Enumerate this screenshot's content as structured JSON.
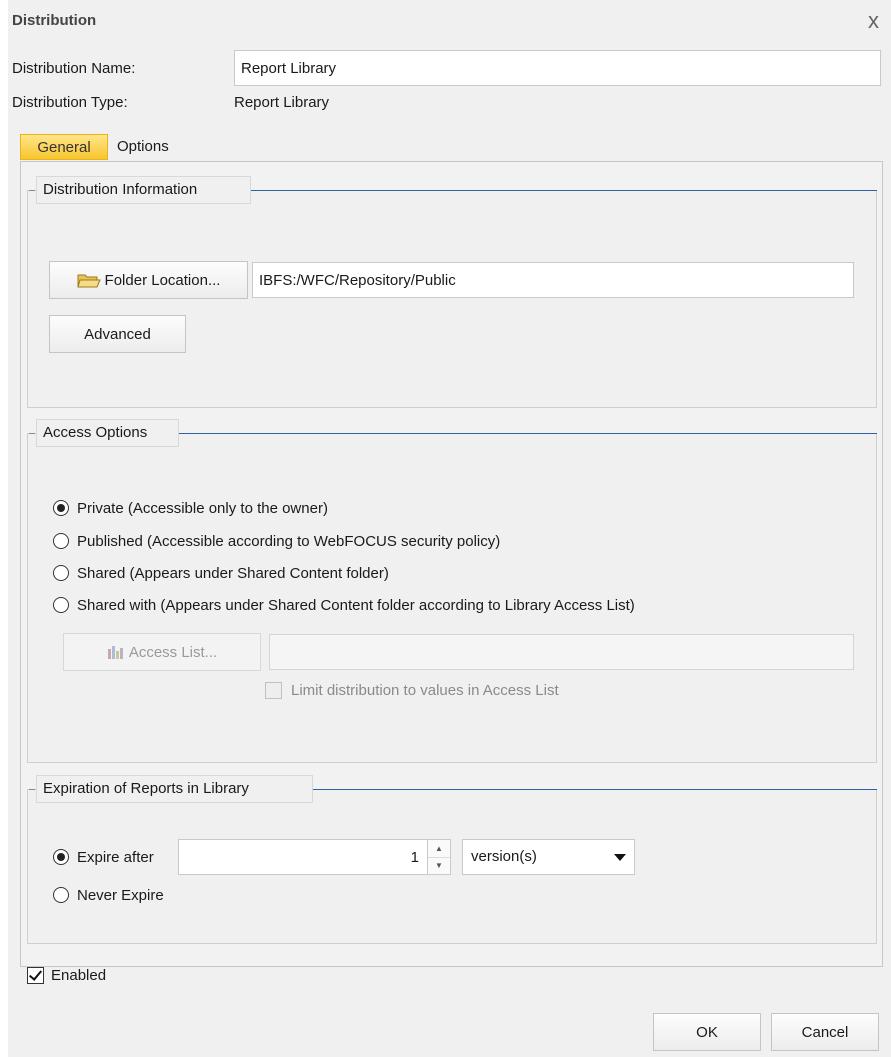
{
  "dialog": {
    "title": "Distribution",
    "close_glyph": "x"
  },
  "fields": {
    "name_label": "Distribution Name:",
    "name_value": "Report Library",
    "type_label": "Distribution Type:",
    "type_value": "Report Library"
  },
  "tabs": [
    {
      "label": "General",
      "active": true
    },
    {
      "label": "Options",
      "active": false
    }
  ],
  "distribution_info": {
    "legend": "Distribution Information",
    "folder_button": "Folder Location...",
    "folder_icon": "folder-open-icon",
    "folder_path": "IBFS:/WFC/Repository/Public",
    "advanced_button": "Advanced"
  },
  "access_options": {
    "legend": "Access Options",
    "radios": [
      {
        "label": "Private (Accessible only to the owner)",
        "checked": true
      },
      {
        "label": "Published (Accessible according to WebFOCUS security policy)",
        "checked": false
      },
      {
        "label": "Shared (Appears under Shared Content folder)",
        "checked": false
      },
      {
        "label": "Shared with (Appears under Shared Content folder according to Library Access List)",
        "checked": false
      }
    ],
    "access_list_button": "Access List...",
    "access_list_icon": "access-list-icon",
    "access_list_value": "",
    "limit_checkbox_label": "Limit distribution to values in Access List",
    "limit_checked": false
  },
  "expiration": {
    "legend": "Expiration of Reports in Library",
    "expire_after_label": "Expire after",
    "expire_after_checked": true,
    "expire_value": "1",
    "unit_value": "version(s)",
    "never_expire_label": "Never Expire",
    "never_expire_checked": false
  },
  "enabled": {
    "label": "Enabled",
    "checked": true
  },
  "footer": {
    "ok": "OK",
    "cancel": "Cancel"
  }
}
